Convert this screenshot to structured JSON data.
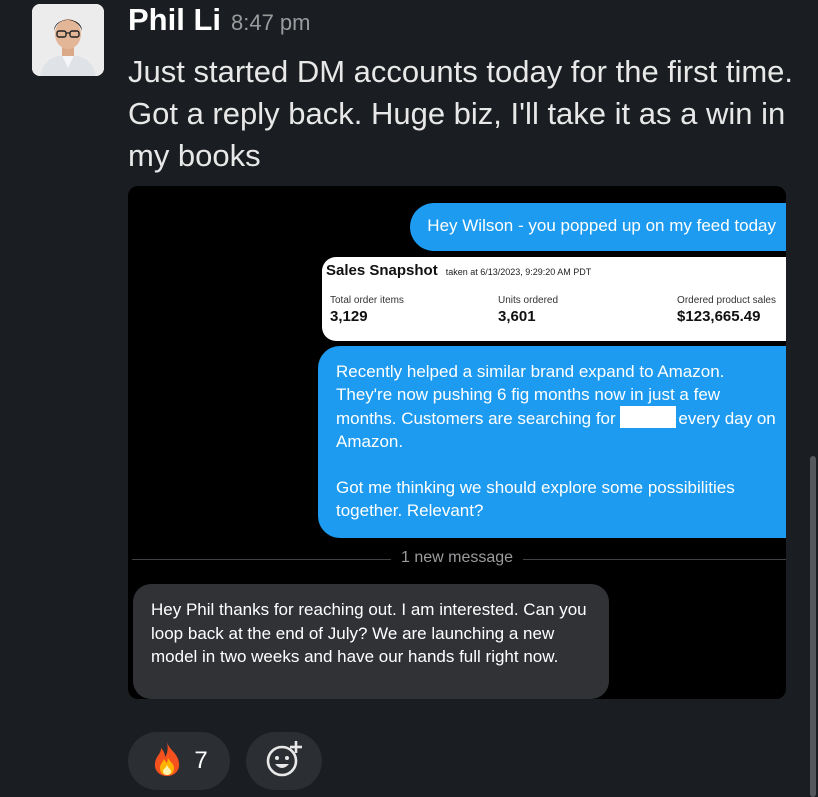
{
  "post": {
    "author": "Phil Li",
    "time": "8:47 pm",
    "text": "Just started DM accounts today for the first time. Got a reply back. Huge biz, I'll take it as a win in my books"
  },
  "dm": {
    "opening_message": "Hey Wilson - you popped up on my feed today",
    "snapshot": {
      "title": "Sales Snapshot",
      "taken_at": "taken at 6/13/2023, 9:29:20 AM PDT",
      "metrics": [
        {
          "label": "Total order items",
          "value": "3,129"
        },
        {
          "label": "Units ordered",
          "value": "3,601"
        },
        {
          "label": "Ordered product sales",
          "value": "$123,665.49"
        }
      ]
    },
    "pitch_before_redaction": "Recently helped a similar brand expand to Amazon. They're now pushing 6 fig months now in just a few months. Customers are searching for",
    "pitch_after_redaction": "every day on Amazon.",
    "pitch_paragraph_2": "Got me thinking we should explore some possibilities together. Relevant?",
    "divider_label": "1 new message",
    "reply": "Hey Phil thanks for reaching out. I am interested. Can you loop back at the end of July? We are launching a new model in two weeks and have our hands full right now."
  },
  "reactions": [
    {
      "icon": "fire-icon",
      "emoji": "🔥",
      "count": "7"
    }
  ],
  "colors": {
    "background": "#1a1d21",
    "twitter_blue": "#1d9bf0",
    "reply_gray": "#303236"
  }
}
